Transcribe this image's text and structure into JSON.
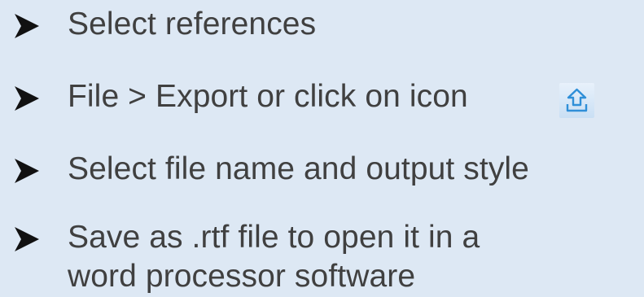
{
  "bullets": [
    {
      "text": "Select references",
      "marker_icon": "arrowhead-bullet-icon"
    },
    {
      "text": "File > Export or click on icon",
      "marker_icon": "arrowhead-bullet-icon",
      "inline_icon": "export-upload-icon"
    },
    {
      "text": "Select file name and output style",
      "marker_icon": "arrowhead-bullet-icon"
    },
    {
      "text_lines": [
        "Save as .rtf file to open it in a",
        "word processor software"
      ],
      "marker_icon": "arrowhead-bullet-icon"
    }
  ],
  "colors": {
    "background": "#dde8f4",
    "text": "#404040",
    "bullet": "#111111",
    "icon_accent": "#2f8fd8"
  }
}
